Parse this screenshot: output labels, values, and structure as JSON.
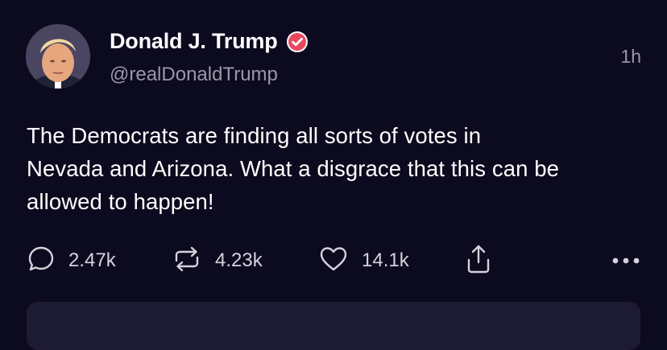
{
  "post": {
    "author": {
      "display_name": "Donald J. Trump",
      "handle": "@realDonaldTrump",
      "verified": true,
      "avatar_icon": "profile-photo"
    },
    "timestamp": "1h",
    "body_lines": [
      "The Democrats are finding all sorts of votes in",
      "Nevada and Arizona. What a disgrace that this can be",
      "allowed to happen!"
    ],
    "actions": {
      "replies": "2.47k",
      "reposts": "4.23k",
      "likes": "14.1k"
    },
    "icons": {
      "reply": "speech-bubble-icon",
      "repost": "repost-arrows-icon",
      "like": "heart-icon",
      "share": "share-icon",
      "more": "ellipsis-icon"
    }
  },
  "colors": {
    "background": "#0c0a1e",
    "text_primary": "#ffffff",
    "text_secondary": "#9a97a8",
    "verified_badge": "#e8485f",
    "card": "#1d1a33"
  }
}
